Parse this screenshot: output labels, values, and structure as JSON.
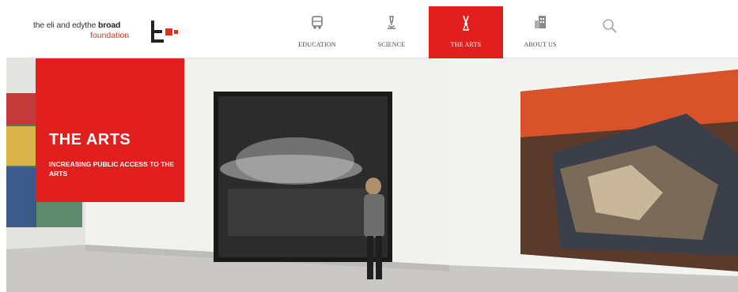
{
  "brand": {
    "line1_prefix": "the eli and edythe",
    "line1_bold": "broad",
    "line2": "foundation",
    "colors": {
      "accent": "#e11f1f",
      "logo_orange": "#e0301e"
    }
  },
  "nav": {
    "items": [
      {
        "label": "EDUCATION",
        "icon": "school-bus-icon",
        "active": false
      },
      {
        "label": "SCIENCE",
        "icon": "microscope-icon",
        "active": false
      },
      {
        "label": "THE ARTS",
        "icon": "paintbrush-icon",
        "active": true
      },
      {
        "label": "ABOUT US",
        "icon": "building-icon",
        "active": false
      }
    ],
    "search_icon": "search-icon"
  },
  "hero": {
    "title": "THE ARTS",
    "subtitle": "INCREASING PUBLIC ACCESS TO THE ARTS"
  }
}
